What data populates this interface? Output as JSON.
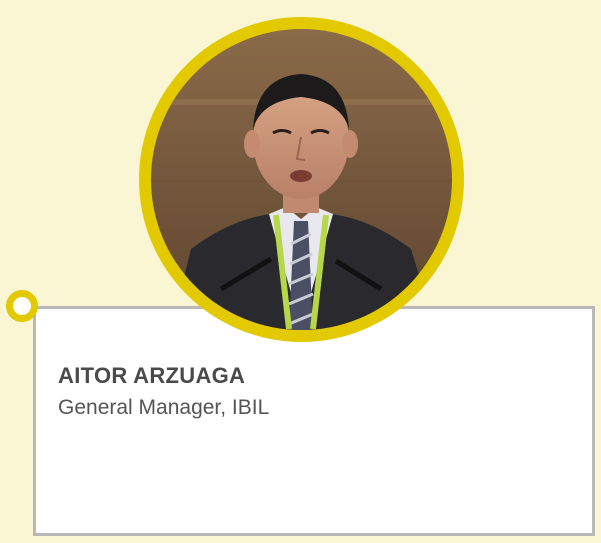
{
  "profile": {
    "name": "AITOR ARZUAGA",
    "role": "General Manager, IBIL",
    "accent_color": "#e2c900",
    "background_color": "#faf5d3",
    "border_color": "#b8b8b8"
  },
  "icons": {
    "timeline_dot": "circle-marker-icon"
  }
}
